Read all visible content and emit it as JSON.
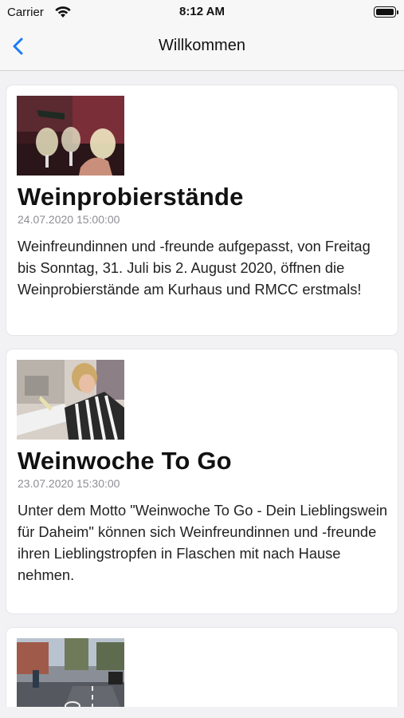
{
  "status_bar": {
    "carrier": "Carrier",
    "time": "8:12 AM"
  },
  "nav": {
    "title": "Willkommen",
    "back_icon": "chevron-left-icon"
  },
  "colors": {
    "accent": "#1a7cf5",
    "date_gray": "#8e8e93",
    "background": "#f2f2f4"
  },
  "articles": [
    {
      "title": "Weinprobierstände",
      "date": "24.07.2020 15:00:00",
      "text": "Weinfreundinnen und -freunde aufgepasst, von Freitag bis Sonntag, 31. Juli bis 2. August 2020, öffnen die Weinprobierstände am Kurhaus und RMCC erstmals!"
    },
    {
      "title": "Weinwoche To Go",
      "date": "23.07.2020 15:30:00",
      "text": "Unter dem Motto \"Weinwoche To Go - Dein Lieblingswein für Daheim\" können sich Weinfreundinnen und -freunde ihren Lieblingstropfen in Flaschen mit nach Hause nehmen."
    },
    {
      "title": "",
      "date": "",
      "text": ""
    }
  ]
}
